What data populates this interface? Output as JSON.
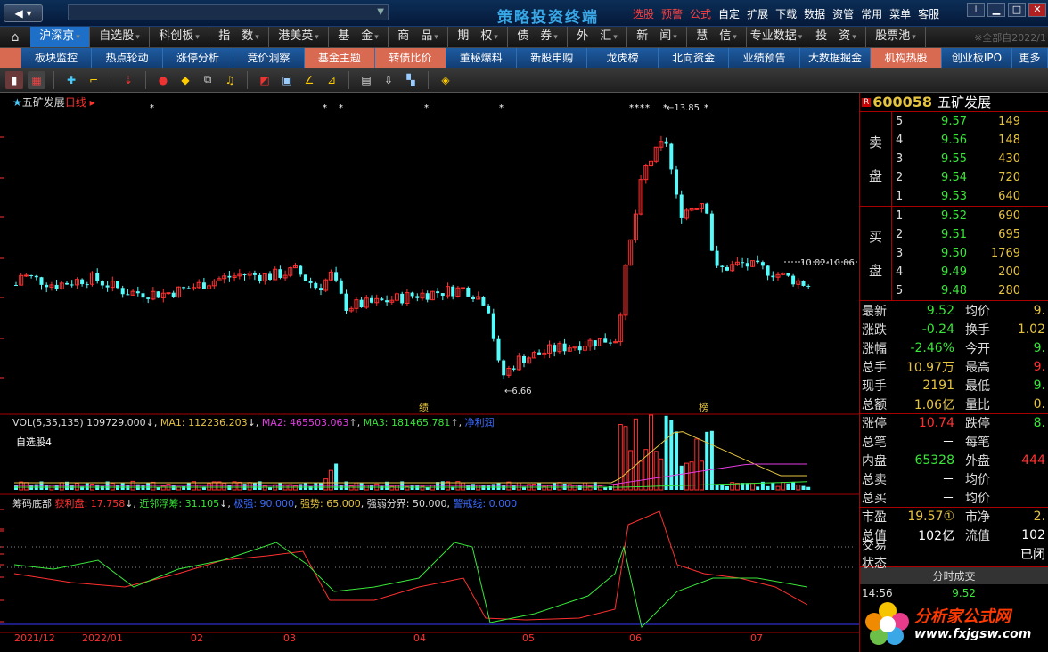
{
  "titlebar": {
    "back": "◀ ▾",
    "app_title": "策略投资终端",
    "menu": [
      {
        "label": "选股",
        "hl": true
      },
      {
        "label": "预警",
        "hl": true
      },
      {
        "label": "公式",
        "hl": true
      },
      {
        "label": "自定",
        "hl": false
      },
      {
        "label": "扩展",
        "hl": false
      },
      {
        "label": "下载",
        "hl": false
      },
      {
        "label": "数据",
        "hl": false
      },
      {
        "label": "资管",
        "hl": false
      },
      {
        "label": "常用",
        "hl": false
      },
      {
        "label": "菜单",
        "hl": false
      },
      {
        "label": "客服",
        "hl": false
      }
    ]
  },
  "navbar": {
    "items": [
      "沪深京",
      "自选股",
      "科创板",
      "指　数",
      "港美英",
      "基　金",
      "商　品",
      "期　权",
      "债　券",
      "外　汇",
      "新　闻",
      "慧　信",
      "专业数据",
      "投　资",
      "股票池"
    ],
    "right_text": "※全部自2022/1"
  },
  "subnav": {
    "items": [
      {
        "label": "板块监控",
        "hot": false
      },
      {
        "label": "热点轮动",
        "hot": false
      },
      {
        "label": "涨停分析",
        "hot": false
      },
      {
        "label": "竞价洞察",
        "hot": false
      },
      {
        "label": "基金主题",
        "hot": true
      },
      {
        "label": "转债比价",
        "hot": true
      },
      {
        "label": "董秘爆料",
        "hot": false
      },
      {
        "label": "新股申购",
        "hot": false
      },
      {
        "label": "龙虎榜",
        "hot": false
      },
      {
        "label": "北向资金",
        "hot": false
      },
      {
        "label": "业绩预告",
        "hot": false
      },
      {
        "label": "大数据掘金",
        "hot": false
      },
      {
        "label": "机构热股",
        "hot": true
      },
      {
        "label": "创业板IPO",
        "hot": false
      },
      {
        "label": "更多",
        "hot": false
      }
    ]
  },
  "chart": {
    "stock_title": "五矿发展",
    "period": "日线",
    "high_label": "←13.85",
    "low_label": "←6.66",
    "annotation": "10.02-10.06",
    "events": [
      {
        "label": "绩"
      },
      {
        "label": "榜"
      }
    ],
    "vol_header": {
      "vol": "VOL(5,35,135)  109729.000",
      "ma1": "MA1: 112236.203",
      "ma2": "MA2: 465503.063",
      "ma3": "MA3: 181465.781",
      "extra": "净利润"
    },
    "fav_label": "自选股4",
    "chip_header": {
      "name": "筹码底部",
      "a": "获利盘: 17.758",
      "b": "近邻浮筹: 31.105",
      "c": "极强: 90.000",
      "d": "强势: 65.000",
      "e": "强弱分界: 50.000",
      "f": "警戒线: 0.000"
    },
    "x_labels": [
      "2021/12",
      "2022/01",
      "02",
      "03",
      "04",
      "05",
      "06",
      "07"
    ]
  },
  "quote": {
    "code": "600058",
    "name": "五矿发展",
    "sell_label": [
      "卖",
      "盘"
    ],
    "buy_label": [
      "买",
      "盘"
    ],
    "asks": [
      {
        "level": "5",
        "price": "9.57",
        "vol": "149"
      },
      {
        "level": "4",
        "price": "9.56",
        "vol": "148"
      },
      {
        "level": "3",
        "price": "9.55",
        "vol": "430"
      },
      {
        "level": "2",
        "price": "9.54",
        "vol": "720"
      },
      {
        "level": "1",
        "price": "9.53",
        "vol": "640"
      }
    ],
    "bids": [
      {
        "level": "1",
        "price": "9.52",
        "vol": "690"
      },
      {
        "level": "2",
        "price": "9.51",
        "vol": "695"
      },
      {
        "level": "3",
        "price": "9.50",
        "vol": "1769"
      },
      {
        "level": "4",
        "price": "9.49",
        "vol": "200"
      },
      {
        "level": "5",
        "price": "9.48",
        "vol": "280"
      }
    ],
    "stats": [
      {
        "k": "最新",
        "v": "9.52",
        "vc": "green",
        "k2": "均价",
        "v2": "9.",
        "v2c": "yellow"
      },
      {
        "k": "涨跌",
        "v": "-0.24",
        "vc": "green",
        "k2": "换手",
        "v2": "1.02",
        "v2c": "yellow"
      },
      {
        "k": "涨幅",
        "v": "-2.46%",
        "vc": "green",
        "k2": "今开",
        "v2": "9.",
        "v2c": "green"
      },
      {
        "k": "总手",
        "v": "10.97万",
        "vc": "yellow",
        "k2": "最高",
        "v2": "9.",
        "v2c": "red"
      },
      {
        "k": "现手",
        "v": "2191",
        "vc": "yellow",
        "k2": "最低",
        "v2": "9.",
        "v2c": "green"
      },
      {
        "k": "总额",
        "v": "1.06亿",
        "vc": "yellow",
        "k2": "量比",
        "v2": "0.",
        "v2c": "yellow"
      },
      {
        "k": "涨停",
        "v": "10.74",
        "vc": "red",
        "k2": "跌停",
        "v2": "8.",
        "v2c": "green"
      },
      {
        "k": "总笔",
        "v": "－",
        "vc": "white",
        "k2": "每笔",
        "v2": "",
        "v2c": "white"
      },
      {
        "k": "内盘",
        "v": "65328",
        "vc": "green",
        "k2": "外盘",
        "v2": "444",
        "v2c": "red"
      },
      {
        "k": "总卖",
        "v": "－",
        "vc": "white",
        "k2": "均价",
        "v2": "",
        "v2c": "white"
      },
      {
        "k": "总买",
        "v": "－",
        "vc": "white",
        "k2": "均价",
        "v2": "",
        "v2c": "white"
      },
      {
        "k": "市盈",
        "v": "19.57①",
        "vc": "yellow",
        "k2": "市净",
        "v2": "2.",
        "v2c": "yellow"
      },
      {
        "k": "总值",
        "v": "102亿",
        "vc": "white",
        "k2": "流值",
        "v2": "102",
        "v2c": "white"
      },
      {
        "k": "交易状态",
        "v": "",
        "vc": "white",
        "k2": "",
        "v2": "已闭",
        "v2c": "white"
      }
    ],
    "tab_label": "分时成交",
    "trade": {
      "time": "14:56",
      "price": "9.52"
    }
  },
  "logo": {
    "text": "分析家公式网",
    "url": "www.fxjgsw.com"
  },
  "colors": {
    "up": "#ff3030",
    "down": "#39e639",
    "candle_down": "#54fcfc",
    "accent": "#1e6fc8"
  }
}
